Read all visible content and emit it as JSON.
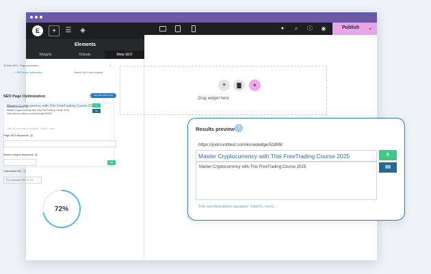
{
  "editor": {
    "panel_title": "Elements",
    "logo_letter": "E",
    "tabs": [
      "Widgets",
      "Globals",
      "Meta SEO"
    ],
    "publish_label": "Publish",
    "drag_text": "Drag widget here"
  },
  "seo_panel": {
    "breadcrumb": "All Meta SEO › Page optimization",
    "seo_score_link": "+ SEO score optimization",
    "tabs_hint": "Search Not Found Analysis",
    "title": "SEO Page Optimization",
    "analyze_button": "RELOAD ANALYSIS",
    "results_preview_label": "Results preview",
    "mini_url": "https://joomunittest.com/knowledge/51899/",
    "mini_title": "Master Cryptocurrency with This FreeTrading Course 2025",
    "mini_desc": "Master Cryptocurrency with This FreeTrading Course 2025",
    "mini_badge_title": "5",
    "mini_badge_desc": "88",
    "mini_footer": "Title and description variables: %title%, more...",
    "keywords_label": "Page SEO keywords",
    "search_keywords_label": "Search engine keywords",
    "search_keyword_badge": "0/0",
    "canonical_label": "Canonical URL",
    "canonical_placeholder": "Put canonical URL in 'Ca...",
    "score_percent": "72%",
    "score_value": 0.72
  },
  "popup": {
    "title": "Results preview",
    "help_icon": "?",
    "url": "https://joomunittest.com/knowledge/51899/",
    "link_title": "Master Cryptocurrency with This FreeTrading Course 2025",
    "description": "Master Cryptocurrency with This FreeTrading Course 2025",
    "title_count": "5",
    "desc_count": "88",
    "footer": "Title and description variables: %title%, more..."
  },
  "colors": {
    "titlebar": "#6b58a8",
    "accent_blue": "#2c7bbf",
    "green": "#3ec88a",
    "teal": "#226c92",
    "publish_pink": "#e8a7e4"
  }
}
